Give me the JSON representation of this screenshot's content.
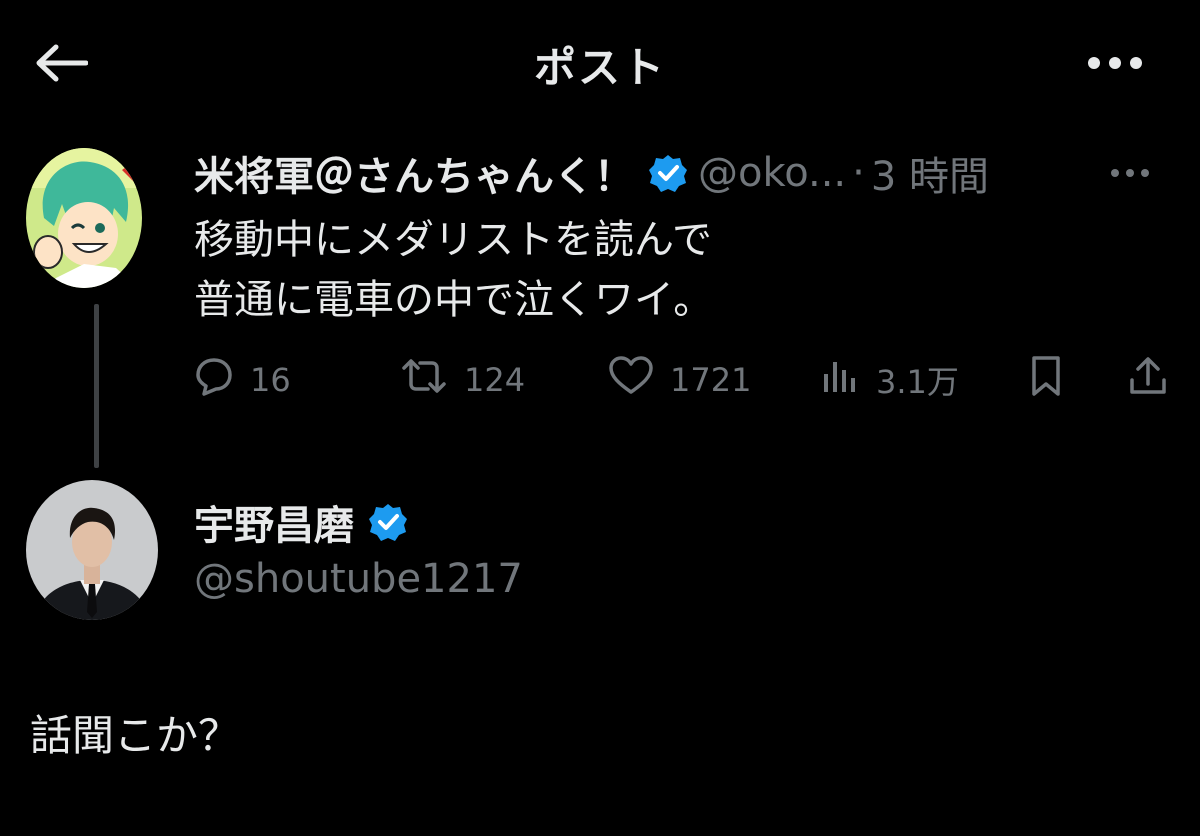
{
  "header": {
    "title": "ポスト",
    "back_icon": "arrow-left-icon",
    "more_icon": "more-horizontal-icon"
  },
  "parent_tweet": {
    "display_name": "米将軍＠さんちゃんく！",
    "verified": true,
    "handle": "@oko...",
    "separator": "·",
    "time": "3 時間",
    "text_lines": [
      "移動中にメダリストを読んで",
      "普通に電車の中で泣くワイ。"
    ],
    "stats": {
      "replies": "16",
      "retweets": "124",
      "likes": "1721",
      "views": "3.1万"
    }
  },
  "reply": {
    "display_name": "宇野昌磨",
    "verified": true,
    "handle": "@shoutube1217",
    "text": "話聞こか？"
  },
  "colors": {
    "background": "#000000",
    "text_primary": "#e7e9ea",
    "text_secondary": "#71767b",
    "verified_blue": "#1d9bf0",
    "thread_line": "#3e4144"
  }
}
